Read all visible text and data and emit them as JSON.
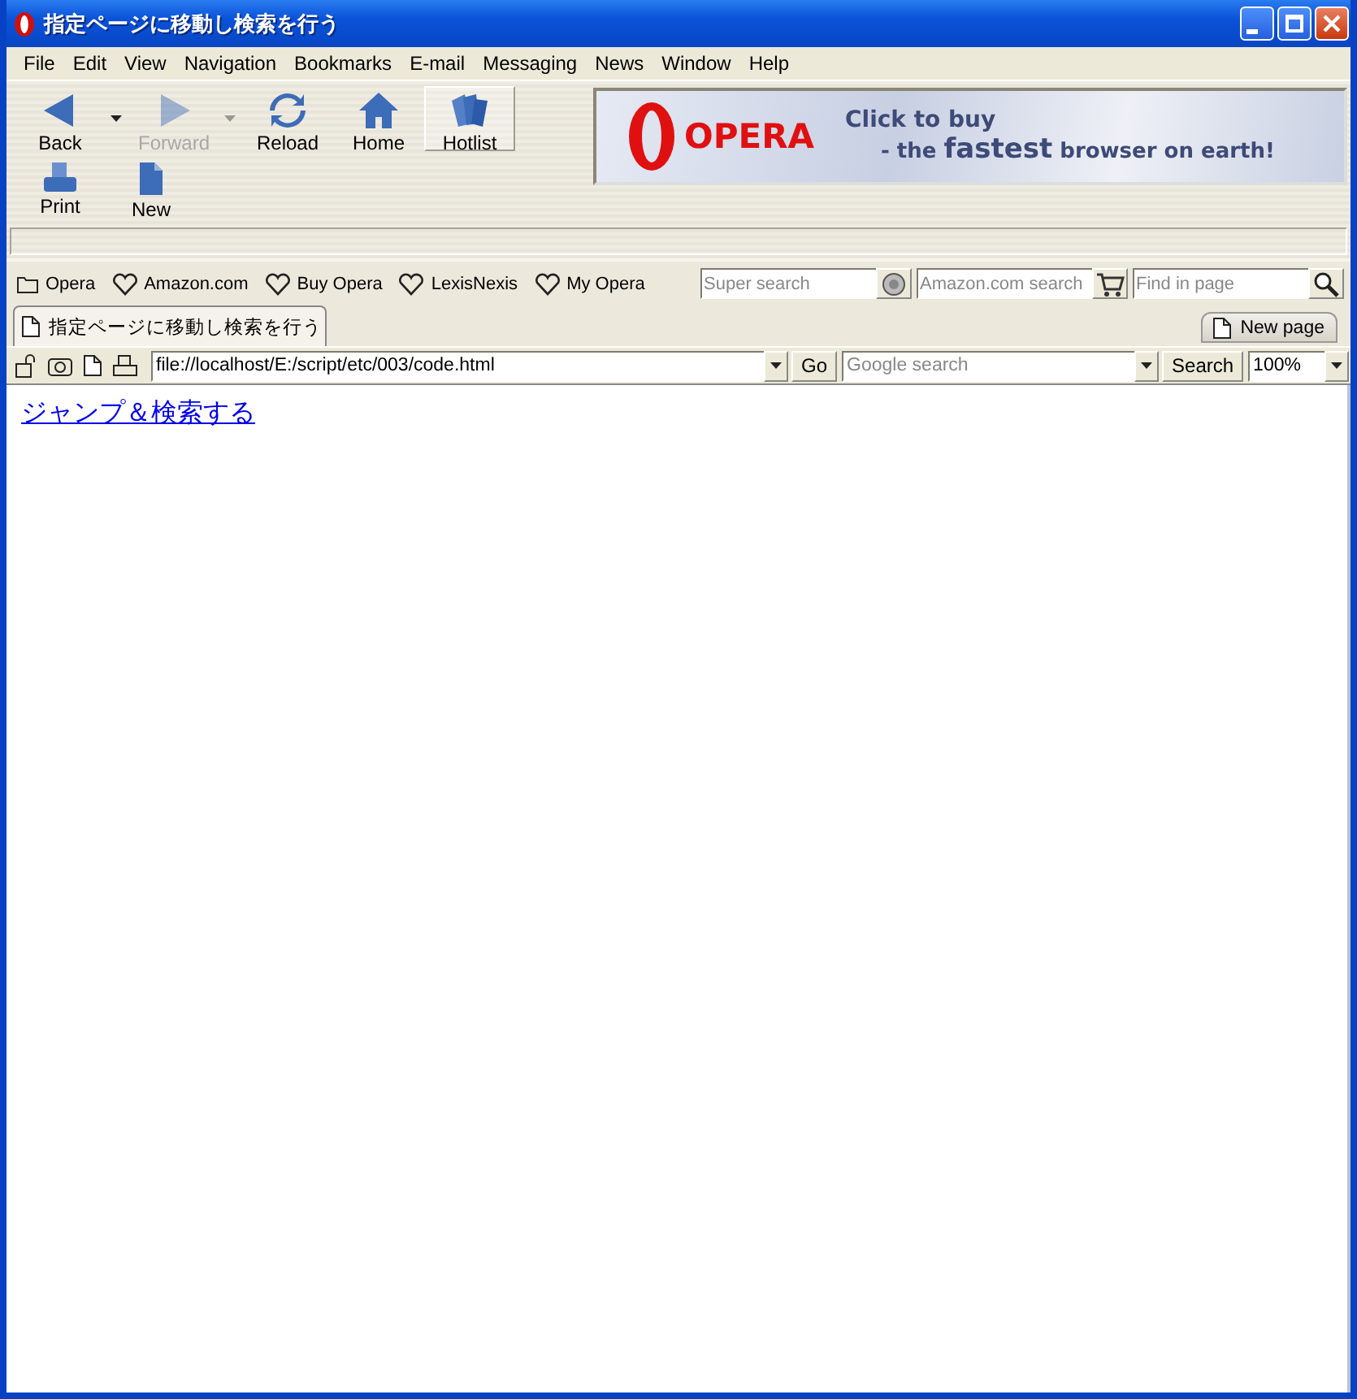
{
  "window": {
    "title": "指定ページに移動し検索を行う"
  },
  "menu": [
    {
      "label": "File"
    },
    {
      "label": "Edit"
    },
    {
      "label": "View"
    },
    {
      "label": "Navigation"
    },
    {
      "label": "Bookmarks"
    },
    {
      "label": "E-mail"
    },
    {
      "label": "Messaging"
    },
    {
      "label": "News"
    },
    {
      "label": "Window"
    },
    {
      "label": "Help"
    }
  ],
  "toolbar": {
    "rows": [
      [
        {
          "label": "Back",
          "kind": "back",
          "disabled": false,
          "pressed": false,
          "dropdown": true
        },
        {
          "label": "Forward",
          "kind": "forward",
          "disabled": true,
          "pressed": false,
          "dropdown": true
        },
        {
          "label": "Reload",
          "kind": "reload",
          "disabled": false,
          "pressed": false,
          "dropdown": false
        },
        {
          "label": "Home",
          "kind": "home",
          "disabled": false,
          "pressed": false,
          "dropdown": false
        },
        {
          "label": "Hotlist",
          "kind": "hotlist",
          "disabled": false,
          "pressed": true,
          "dropdown": false
        }
      ],
      [
        {
          "label": "Print",
          "kind": "print",
          "disabled": false,
          "pressed": false,
          "dropdown": false
        },
        {
          "label": "New",
          "kind": "new",
          "disabled": false,
          "pressed": false,
          "dropdown": false
        }
      ]
    ]
  },
  "banner": {
    "logo": "OPERA",
    "headline": "Click to buy",
    "tagline": "- the **fastest** browser on earth!"
  },
  "bookmarks": [
    {
      "label": "Opera",
      "kind": "folder"
    },
    {
      "label": "Amazon.com",
      "kind": "bookmark"
    },
    {
      "label": "Buy Opera",
      "kind": "bookmark"
    },
    {
      "label": "LexisNexis",
      "kind": "bookmark"
    },
    {
      "label": "My Opera",
      "kind": "bookmark"
    }
  ],
  "search_fields": [
    {
      "placeholder": "Super search",
      "kind": "super"
    },
    {
      "placeholder": "Amazon.com search",
      "kind": "cart"
    },
    {
      "placeholder": "Find in page",
      "kind": "find"
    }
  ],
  "tabs": [
    {
      "label": "指定ページに移動し検索を行う",
      "selected": true
    }
  ],
  "new_page_button": "New page",
  "address_bar": {
    "value": "file://localhost/E:/script/etc/003/code.html",
    "go_button": "Go"
  },
  "web_search": {
    "placeholder": "Google search",
    "button": "Search"
  },
  "zoom": {
    "value": "100%"
  },
  "page": {
    "link": "ジャンプ＆検索する"
  }
}
